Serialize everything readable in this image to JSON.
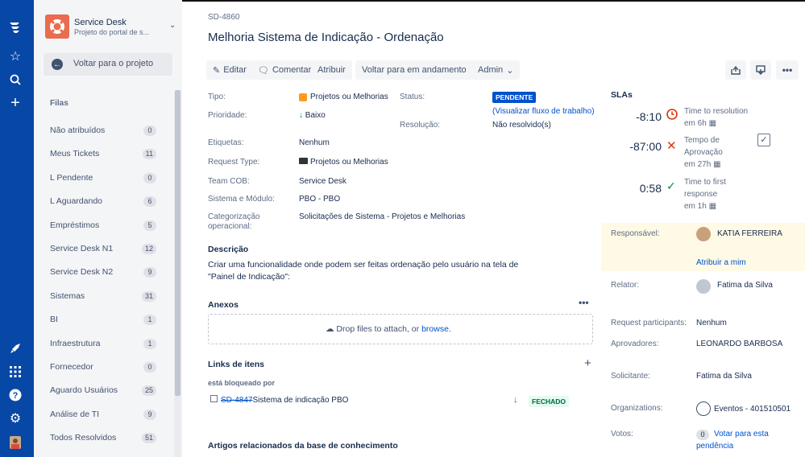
{
  "project": {
    "name": "Service Desk",
    "subtitle": "Projeto do portal de s..."
  },
  "back_label": "Voltar para o projeto",
  "queues_title": "Filas",
  "queues": [
    {
      "label": "Não atribuídos",
      "count": "0"
    },
    {
      "label": "Meus Tickets",
      "count": "11"
    },
    {
      "label": "L Pendente",
      "count": "0"
    },
    {
      "label": "L Aguardando",
      "count": "6"
    },
    {
      "label": "Empréstimos",
      "count": "5"
    },
    {
      "label": "Service Desk N1",
      "count": "12"
    },
    {
      "label": "Service Desk N2",
      "count": "9"
    },
    {
      "label": "Sistemas",
      "count": "31"
    },
    {
      "label": "BI",
      "count": "1"
    },
    {
      "label": "Infraestrutura",
      "count": "1"
    },
    {
      "label": "Fornecedor",
      "count": "0"
    },
    {
      "label": "Aguardo Usuários",
      "count": "25"
    },
    {
      "label": "Análise de TI",
      "count": "9"
    },
    {
      "label": "Todos Resolvidos",
      "count": "51"
    }
  ],
  "issue": {
    "key": "SD-4860",
    "title": "Melhoria Sistema de Indicação - Ordenação"
  },
  "toolbar": {
    "edit": "Editar",
    "comment": "Comentar",
    "assign": "Atribuir",
    "back_progress": "Voltar para em andamento",
    "admin": "Admin"
  },
  "fields": {
    "tipo_label": "Tipo:",
    "tipo": "Projetos ou Melhorias",
    "prioridade_label": "Prioridade:",
    "prioridade": "Baixo",
    "status_label": "Status:",
    "status": "PENDENTE",
    "status_link": "(Visualizar fluxo de trabalho)",
    "resolucao_label": "Resolução:",
    "resolucao": "Não resolvido(s)",
    "etiquetas_label": "Etiquetas:",
    "etiquetas": "Nenhum",
    "request_type_label": "Request Type:",
    "request_type": "Projetos ou Melhorias",
    "team_label": "Team COB:",
    "team": "Service Desk",
    "sistema_label": "Sistema e Módulo:",
    "sistema": "PBO - PBO",
    "categ_label_1": "Categorização",
    "categ_label_2": "operacional:",
    "categ": "Solicitações de Sistema - Projetos e Melhorias"
  },
  "description": {
    "title": "Descrição",
    "text": "Criar uma funcionalidade onde podem ser feitas ordenação pelo usuário na tela de \"Painel de Indicação\":"
  },
  "attachments": {
    "title": "Anexos",
    "drop_text": "Drop files to attach, or ",
    "browse": "browse."
  },
  "links": {
    "title": "Links de itens",
    "relation": "está bloqueado por",
    "key": "SD-4847",
    "summary": "Sistema de indicação PBO",
    "status": "FECHADO"
  },
  "kb_title": "Artigos relacionados da base de conhecimento",
  "slas": {
    "title": "SLAs",
    "items": [
      {
        "time": "-8:10",
        "label_1": "Time to resolution",
        "label_2": "em 6h"
      },
      {
        "time": "-87:00",
        "label_1": "Tempo de",
        "label_2": "Aprovação",
        "label_3": "em 27h"
      },
      {
        "time": "0:58",
        "label_1": "Time to first",
        "label_2": "response",
        "label_3": "em 1h"
      }
    ]
  },
  "people": {
    "responsavel_label": "Responsável:",
    "responsavel": "KATIA FERREIRA",
    "assign_me": "Atribuir a mim",
    "relator_label": "Relator:",
    "relator": "Fatima da Silva",
    "participants_label": "Request participants:",
    "participants": "Nenhum",
    "aprovadores_label": "Aprovadores:",
    "aprovadores": "LEONARDO BARBOSA",
    "solicitante_label": "Solicitante:",
    "solicitante": "Fatima da Silva",
    "org_label": "Organizations:",
    "org": "Eventos - 401510501",
    "votos_label": "Votos:",
    "votos_count": "0",
    "votos_link_1": "Votar para esta",
    "votos_link_2": "pendência"
  },
  "colors": {
    "nav": "#0747a6",
    "link": "#0052cc",
    "highlight": "#fffae6",
    "success": "#00875a"
  }
}
